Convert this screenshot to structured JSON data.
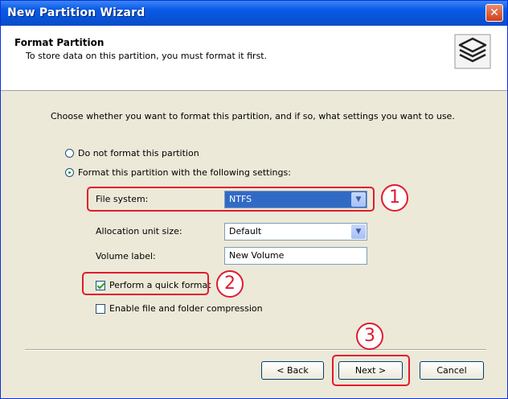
{
  "window": {
    "title": "New Partition Wizard",
    "close_glyph": "✕"
  },
  "header": {
    "title": "Format Partition",
    "subtitle": "To store data on this partition, you must format it first.",
    "icon": "disk-stack-icon"
  },
  "body": {
    "instruction": "Choose whether you want to format this partition, and if so, what settings you want to use.",
    "radio_no_format": "Do not format this partition",
    "radio_format": "Format this partition with the following settings:",
    "file_system_label": "File system:",
    "file_system_value": "NTFS",
    "allocation_label": "Allocation unit size:",
    "allocation_value": "Default",
    "volume_label_label": "Volume label:",
    "volume_label_value": "New Volume",
    "quick_format": "Perform a quick format",
    "compression": "Enable file and folder compression",
    "dropdown_glyph": "▼"
  },
  "annotations": {
    "n1": "1",
    "n2": "2",
    "n3": "3"
  },
  "buttons": {
    "back": "< Back",
    "next": "Next >",
    "cancel": "Cancel"
  },
  "colors": {
    "highlight": "#e11a2f",
    "titlebar": "#0a5ae6",
    "selection": "#316ac5"
  }
}
